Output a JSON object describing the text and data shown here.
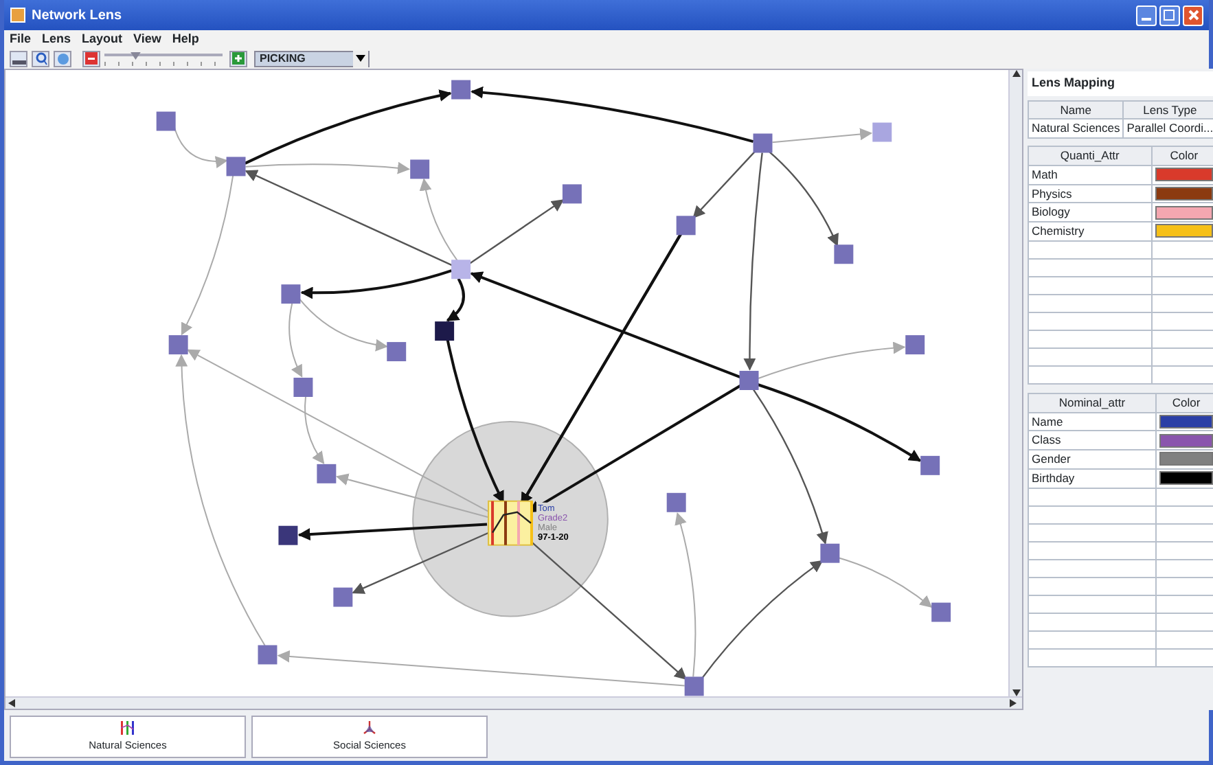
{
  "window": {
    "title": "Network Lens"
  },
  "menu": [
    "File",
    "Lens",
    "Layout",
    "View",
    "Help"
  ],
  "toolbar": {
    "zoom": {
      "level": 0.27
    },
    "mode": "PICKING"
  },
  "lens_node": {
    "labels": [
      "Tom",
      "Grade2",
      "Male",
      "97-1-20"
    ]
  },
  "panel": {
    "title": "Lens Mapping",
    "lens_table": {
      "columns": [
        "Name",
        "Lens Type"
      ],
      "rows": [
        [
          "Natural Sciences",
          "Parallel Coordi..."
        ]
      ]
    },
    "quanti_table": {
      "columns": [
        "Quanti_Attr",
        "Color"
      ],
      "rows": [
        {
          "name": "Math",
          "color": "#d93a2b"
        },
        {
          "name": "Physics",
          "color": "#8b3a10"
        },
        {
          "name": "Biology",
          "color": "#f4a7b0"
        },
        {
          "name": "Chemistry",
          "color": "#f6c018"
        }
      ]
    },
    "nominal_table": {
      "columns": [
        "Nominal_attr",
        "Color"
      ],
      "rows": [
        {
          "name": "Name",
          "color": "#2b3fa6"
        },
        {
          "name": "Class",
          "color": "#8a55ad"
        },
        {
          "name": "Gender",
          "color": "#808080"
        },
        {
          "name": "Birthday",
          "color": "#000000"
        }
      ]
    }
  },
  "lens_tabs": [
    {
      "label": "Natural Sciences",
      "kind": "parallel"
    },
    {
      "label": "Social Sciences",
      "kind": "star"
    }
  ]
}
